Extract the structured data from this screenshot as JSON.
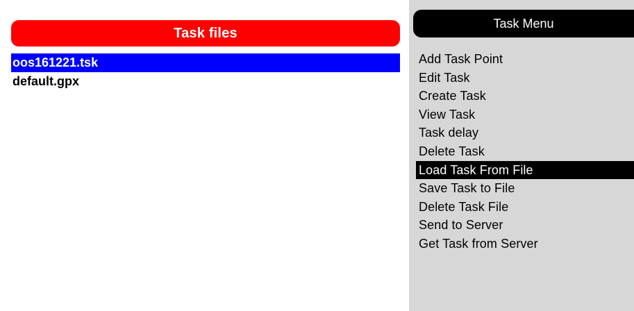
{
  "files_panel": {
    "title": "Task files",
    "files": [
      {
        "name": "oos161221.tsk",
        "selected": true
      },
      {
        "name": "default.gpx",
        "selected": false
      }
    ]
  },
  "menu_panel": {
    "title": "Task Menu",
    "items": [
      {
        "label": "Add Task Point",
        "selected": false
      },
      {
        "label": "Edit Task",
        "selected": false
      },
      {
        "label": "Create Task",
        "selected": false
      },
      {
        "label": "View Task",
        "selected": false
      },
      {
        "label": "Task delay",
        "selected": false
      },
      {
        "label": "Delete Task",
        "selected": false
      },
      {
        "label": "Load Task From File",
        "selected": true
      },
      {
        "label": "Save Task to File",
        "selected": false
      },
      {
        "label": "Delete Task File",
        "selected": false
      },
      {
        "label": "Send to Server",
        "selected": false
      },
      {
        "label": "Get Task from Server",
        "selected": false
      }
    ]
  },
  "colors": {
    "files_header_bg": "#ff0000",
    "file_selection_bg": "#0000ff",
    "menu_bg": "#d7d7d7",
    "menu_header_bg": "#000000",
    "menu_selection_bg": "#000000"
  }
}
